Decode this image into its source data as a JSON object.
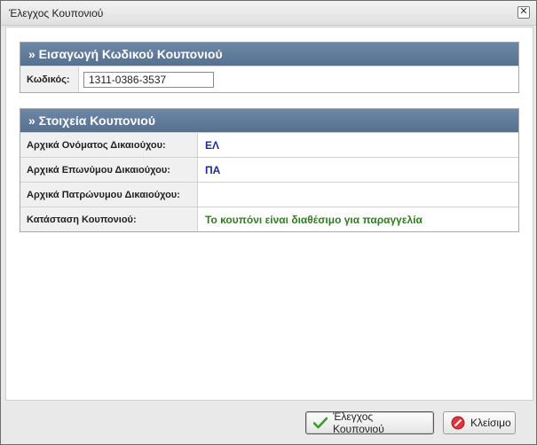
{
  "dialog": {
    "title": "Έλεγχος Κουπονιού",
    "close_glyph": "✕"
  },
  "entry_panel": {
    "header": "» Εισαγωγή Κωδικού Κουπονιού",
    "code_label": "Κωδικός:",
    "code_value": "1311-0386-3537"
  },
  "details_panel": {
    "header": "» Στοιχεία Κουπονιού",
    "rows": [
      {
        "label": "Αρχικά Ονόματος Δικαιούχου:",
        "value": "ΕΛ"
      },
      {
        "label": "Αρχικά Επωνύμου Δικαιούχου:",
        "value": "ΠΑ"
      },
      {
        "label": "Αρχικά Πατρώνυμου Δικαιούχου:",
        "value": ""
      },
      {
        "label": "Κατάσταση Κουπονιού:",
        "value": "Το κουπόνι είναι διαθέσιμο για παραγγελία"
      }
    ],
    "status_color": "#2e7d1f",
    "value_color": "#1f2c8f"
  },
  "footer": {
    "check_button": "Έλεγχος Κουπονιού",
    "close_button": "Κλείσιμο",
    "check_icon": "checkmark-icon",
    "close_icon": "cancel-icon"
  },
  "colors": {
    "panel_header": "#5f7898"
  }
}
